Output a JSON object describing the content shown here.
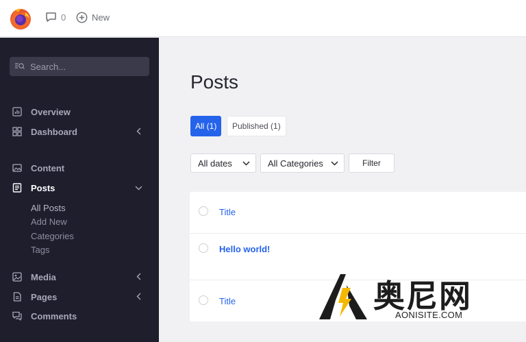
{
  "topbar": {
    "comments_count": "0",
    "new_label": "New"
  },
  "sidebar": {
    "search_placeholder": "Search...",
    "items": [
      {
        "label": "Overview",
        "icon": "chart-icon"
      },
      {
        "label": "Dashboard",
        "icon": "grid-icon"
      },
      {
        "label": "Content",
        "icon": "image-icon"
      },
      {
        "label": "Posts",
        "icon": "document-icon"
      },
      {
        "label": "Media",
        "icon": "photo-icon"
      },
      {
        "label": "Pages",
        "icon": "page-icon"
      },
      {
        "label": "Comments",
        "icon": "comments-icon"
      }
    ],
    "posts_sub": [
      "All Posts",
      "Add New",
      "Categories",
      "Tags"
    ]
  },
  "main": {
    "title": "Posts",
    "tabs": [
      {
        "label": "All (1)",
        "active": true
      },
      {
        "label": "Published (1)",
        "active": false
      }
    ],
    "filters": {
      "dates": "All dates",
      "categories": "All Categories",
      "button": "Filter"
    },
    "rows": [
      "Title",
      "Hello world!",
      "Title"
    ]
  },
  "watermark": {
    "chinese": "奥尼网",
    "url": "AONISITE.COM"
  },
  "colors": {
    "accent": "#2563eb",
    "sidebar_bg": "#1e1e2d"
  }
}
